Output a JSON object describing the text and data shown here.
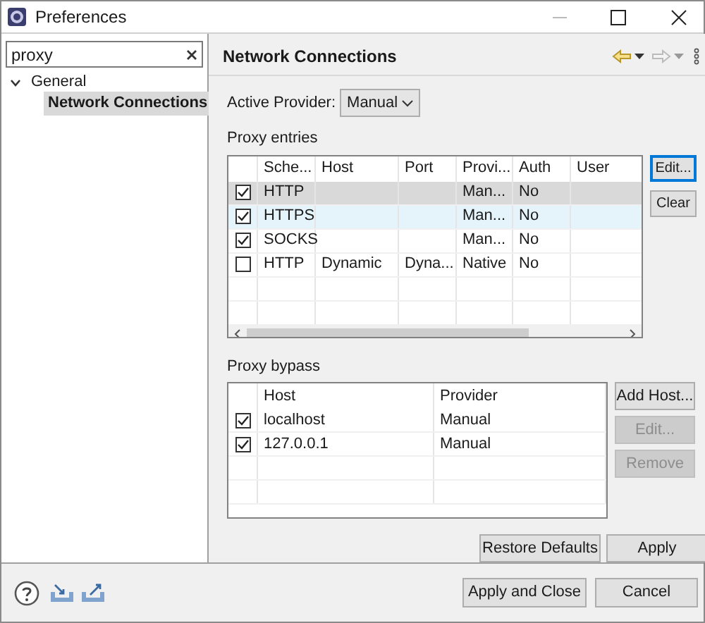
{
  "window": {
    "title": "Preferences"
  },
  "sidebar": {
    "search": {
      "value": "proxy"
    },
    "tree": [
      {
        "label": "General",
        "expanded": true,
        "selected": false,
        "children": [
          {
            "label": "Network Connections",
            "selected": true
          }
        ]
      }
    ]
  },
  "page": {
    "title": "Network Connections",
    "active_provider": {
      "label": "Active Provider:",
      "value": "Manual"
    },
    "proxy_entries": {
      "label": "Proxy entries",
      "columns": [
        "Sche...",
        "Host",
        "Port",
        "Provi...",
        "Auth",
        "User"
      ],
      "rows": [
        {
          "checked": true,
          "selected": true,
          "hovered": false,
          "cells": [
            "HTTP",
            "",
            "",
            "Man...",
            "No",
            ""
          ]
        },
        {
          "checked": true,
          "selected": false,
          "hovered": true,
          "cells": [
            "HTTPS",
            "",
            "",
            "Man...",
            "No",
            ""
          ]
        },
        {
          "checked": true,
          "selected": false,
          "hovered": false,
          "cells": [
            "SOCKS",
            "",
            "",
            "Man...",
            "No",
            ""
          ]
        },
        {
          "checked": false,
          "selected": false,
          "hovered": false,
          "cells": [
            "HTTP",
            "Dynamic",
            "Dyna...",
            "Native",
            "No",
            ""
          ]
        }
      ],
      "buttons": [
        {
          "label": "Edit...",
          "disabled": false,
          "default": true
        },
        {
          "label": "Clear",
          "disabled": false,
          "default": false
        }
      ]
    },
    "proxy_bypass": {
      "label": "Proxy bypass",
      "columns": [
        "Host",
        "Provider"
      ],
      "rows": [
        {
          "checked": true,
          "cells": [
            "localhost",
            "Manual"
          ]
        },
        {
          "checked": true,
          "cells": [
            "127.0.0.1",
            "Manual"
          ]
        }
      ],
      "buttons": [
        {
          "label": "Add Host...",
          "disabled": false
        },
        {
          "label": "Edit...",
          "disabled": true
        },
        {
          "label": "Remove",
          "disabled": true
        }
      ]
    },
    "buttons": [
      "Restore Defaults",
      "Apply"
    ]
  },
  "footer_buttons": [
    "Apply and Close",
    "Cancel"
  ]
}
